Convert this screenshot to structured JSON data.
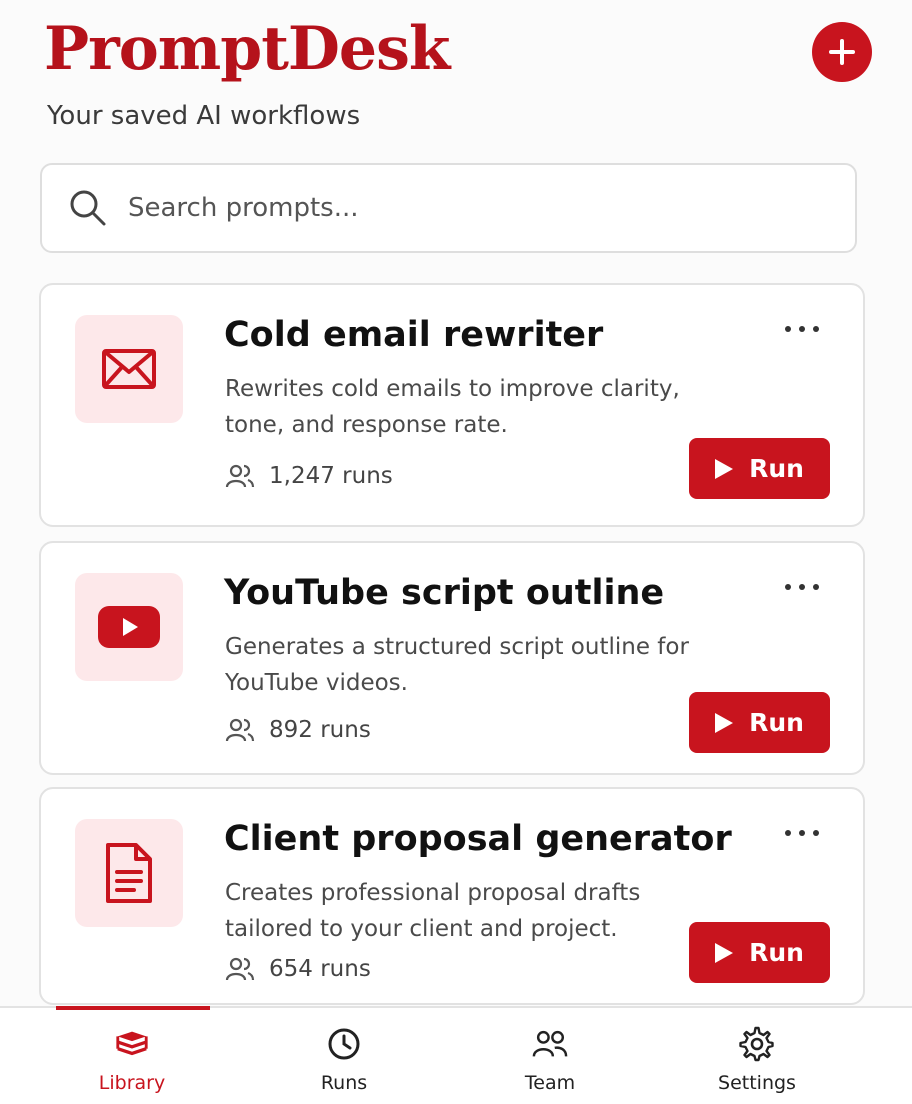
{
  "header": {
    "title": "PromptDesk",
    "subtitle": "Your saved AI workflows",
    "add_button_icon": "plus-icon"
  },
  "search": {
    "placeholder": "Search prompts...",
    "value": "",
    "icon": "search-icon"
  },
  "prompts": [
    {
      "icon": "mail-icon",
      "title": "Cold email rewriter",
      "description": "Rewrites cold emails to improve clarity, tone, and response rate.",
      "runs": "1,247 runs",
      "run_label": "Run"
    },
    {
      "icon": "youtube-icon",
      "title": "YouTube script outline",
      "description": "Generates a structured script outline for YouTube videos.",
      "runs": "892 runs",
      "run_label": "Run"
    },
    {
      "icon": "document-icon",
      "title": "Client proposal generator",
      "description": "Creates professional proposal drafts tailored to your client and project.",
      "runs": "654 runs",
      "run_label": "Run"
    }
  ],
  "nav": {
    "active": "Library",
    "items": [
      {
        "label": "Library",
        "icon": "library-icon"
      },
      {
        "label": "Runs",
        "icon": "clock-icon"
      },
      {
        "label": "Team",
        "icon": "team-icon"
      },
      {
        "label": "Settings",
        "icon": "gear-icon"
      }
    ]
  },
  "colors": {
    "accent": "#c8141e",
    "icon_bg": "#fde8ea"
  }
}
